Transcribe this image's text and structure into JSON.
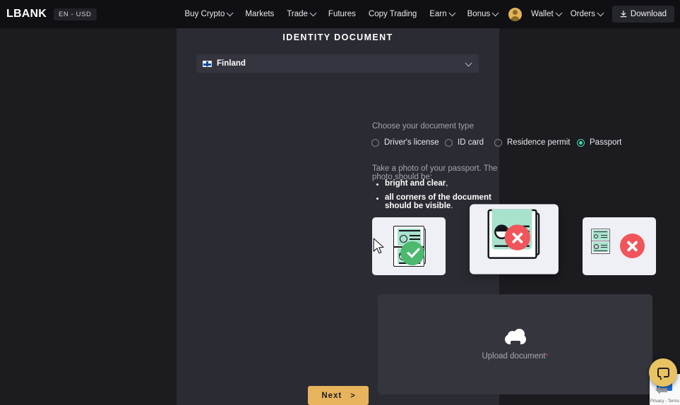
{
  "nav": {
    "brand": "LBANK",
    "lang_badge": "EN - USD",
    "items": [
      {
        "label": "Buy Crypto",
        "has_chevron": true
      },
      {
        "label": "Markets",
        "has_chevron": false
      },
      {
        "label": "Trade",
        "has_chevron": true
      },
      {
        "label": "Futures",
        "has_chevron": false
      },
      {
        "label": "Copy Trading",
        "has_chevron": false
      },
      {
        "label": "Earn",
        "has_chevron": true
      },
      {
        "label": "Bonus",
        "has_chevron": true
      }
    ],
    "wallet": "Wallet",
    "orders": "Orders",
    "download": "Download"
  },
  "form": {
    "title": "IDENTITY DOCUMENT",
    "country": {
      "value": "Finland",
      "flag": "finland-flag-icon"
    },
    "doc_type_label": "Choose your document type",
    "doc_types": [
      {
        "label": "Driver's license",
        "selected": false
      },
      {
        "label": "ID card",
        "selected": false
      },
      {
        "label": "Residence permit",
        "selected": false
      },
      {
        "label": "Passport",
        "selected": true
      }
    ],
    "selected_doc_type": "Passport",
    "instructions_lead": "Take a photo of your passport. The photo should be:",
    "bullets": [
      {
        "bold": "bright and clear",
        "tail": ","
      },
      {
        "bold": "all corners of the document should be visible",
        "tail": "."
      }
    ],
    "examples": [
      {
        "state": "good",
        "badge": "check-badge-icon",
        "hovered": false
      },
      {
        "state": "bad",
        "badge": "x-badge-icon",
        "hovered": true
      },
      {
        "state": "bad",
        "badge": "x-badge-icon",
        "hovered": false
      }
    ],
    "upload": {
      "icon": "cloud-upload-icon",
      "label": "Upload document",
      "required_mark": "*"
    },
    "next_button": {
      "label": "Next",
      "arrow": ">"
    }
  },
  "widgets": {
    "recaptcha_text": "Privacy - Terms",
    "chat_icon": "chat-bubble-icon"
  },
  "colors": {
    "accent_gold": "#e7b35c",
    "radio_selected": "#3bd9ad",
    "good_green": "#4cb96f",
    "bad_red": "#f0555b",
    "required_red": "#e04a4a",
    "panel_bg": "#2b2b33",
    "page_bg": "#1b1b20",
    "nav_bg": "#101014"
  }
}
